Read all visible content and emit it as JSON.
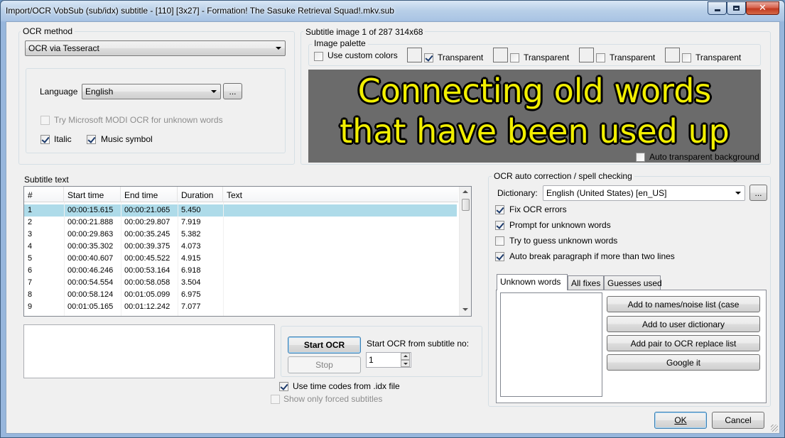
{
  "window": {
    "title": "Import/OCR VobSub (sub/idx) subtitle - [110] [3x27] - Formation! The Sasuke Retrieval Squad!.mkv.sub",
    "accent": "#a9c4e4"
  },
  "ocr_method": {
    "group_label": "OCR method",
    "selected": "OCR via Tesseract",
    "language_label": "Language",
    "language_value": "English",
    "browse_label": "...",
    "modi_label": "Try Microsoft MODI OCR for unknown words",
    "modi_checked": false,
    "italic_label": "Italic",
    "italic_checked": true,
    "music_label": "Music symbol",
    "music_checked": true
  },
  "subtitle_image": {
    "group_label": "Subtitle image 1 of 287   314x68",
    "palette_label": "Image palette",
    "use_custom_colors_label": "Use custom colors",
    "use_custom_colors_checked": false,
    "transparent_label": "Transparent",
    "palette": [
      {
        "checked": true
      },
      {
        "checked": false
      },
      {
        "checked": false
      },
      {
        "checked": false
      }
    ],
    "line1": "Connecting old words",
    "line2": "that have been used up",
    "text_color": "#f2ef00",
    "background_color": "#6b6b6b",
    "auto_transparent_label": "Auto transparent background",
    "auto_transparent_checked": false
  },
  "subtitle_text": {
    "group_label": "Subtitle text",
    "columns": [
      "#",
      "Start time",
      "End time",
      "Duration",
      "Text"
    ],
    "rows": [
      {
        "n": "1",
        "start": "00:00:15.615",
        "end": "00:00:21.065",
        "dur": "5.450",
        "text": ""
      },
      {
        "n": "2",
        "start": "00:00:21.888",
        "end": "00:00:29.807",
        "dur": "7.919",
        "text": ""
      },
      {
        "n": "3",
        "start": "00:00:29.863",
        "end": "00:00:35.245",
        "dur": "5.382",
        "text": ""
      },
      {
        "n": "4",
        "start": "00:00:35.302",
        "end": "00:00:39.375",
        "dur": "4.073",
        "text": ""
      },
      {
        "n": "5",
        "start": "00:00:40.607",
        "end": "00:00:45.522",
        "dur": "4.915",
        "text": ""
      },
      {
        "n": "6",
        "start": "00:00:46.246",
        "end": "00:00:53.164",
        "dur": "6.918",
        "text": ""
      },
      {
        "n": "7",
        "start": "00:00:54.554",
        "end": "00:00:58.058",
        "dur": "3.504",
        "text": ""
      },
      {
        "n": "8",
        "start": "00:00:58.124",
        "end": "00:01:05.099",
        "dur": "6.975",
        "text": ""
      },
      {
        "n": "9",
        "start": "00:01:05.165",
        "end": "00:01:12.242",
        "dur": "7.077",
        "text": ""
      }
    ],
    "selected_row": 0,
    "selection_color": "#aedbe9"
  },
  "ocr_controls": {
    "start_label": "Start OCR",
    "stop_label": "Stop",
    "start_from_label": "Start OCR from subtitle no:",
    "start_from_value": "1",
    "use_timecodes_label": "Use time codes from .idx file",
    "use_timecodes_checked": true,
    "forced_only_label": "Show only forced subtitles",
    "forced_only_checked": false
  },
  "auto_correction": {
    "group_label": "OCR auto correction / spell checking",
    "dictionary_label": "Dictionary:",
    "dictionary_value": "English (United States) [en_US]",
    "browse_label": "...",
    "options": [
      {
        "label": "Fix OCR errors",
        "checked": true
      },
      {
        "label": "Prompt for unknown words",
        "checked": true
      },
      {
        "label": "Try to guess unknown words",
        "checked": false
      },
      {
        "label": "Auto break paragraph if more than two lines",
        "checked": true
      }
    ],
    "tabs": [
      "Unknown words",
      "All fixes",
      "Guesses used"
    ],
    "active_tab": 0,
    "actions": [
      "Add to names/noise list (case",
      "Add to user dictionary",
      "Add pair to OCR replace list",
      "Google it"
    ]
  },
  "footer": {
    "ok_label": "OK",
    "cancel_label": "Cancel"
  }
}
